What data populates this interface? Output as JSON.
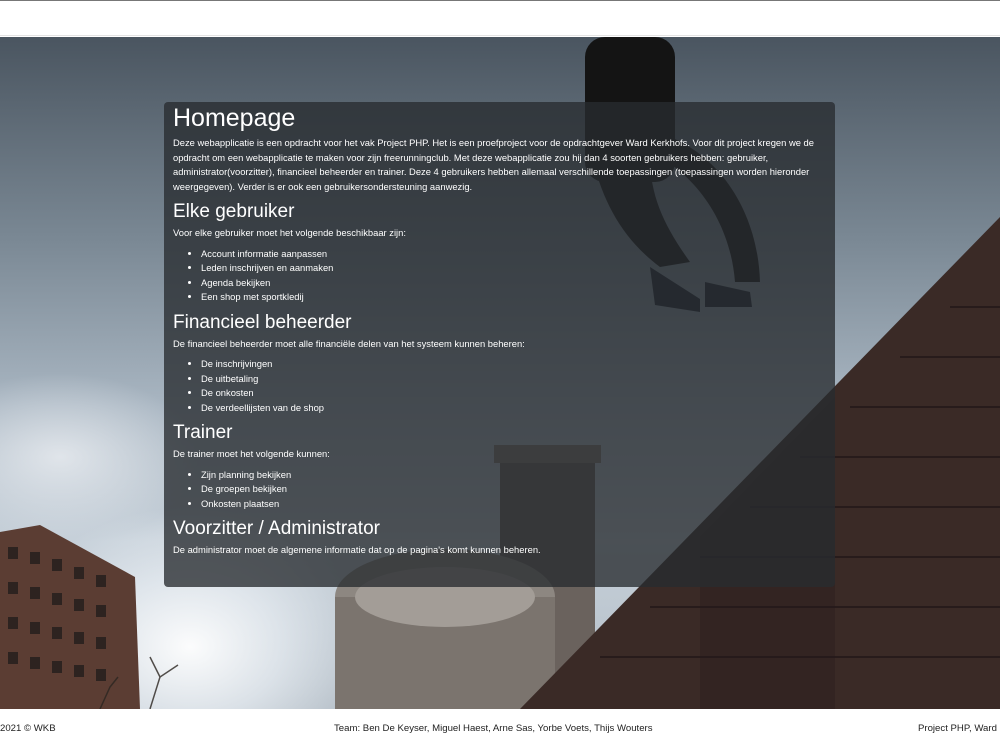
{
  "homepage": {
    "title": "Homepage",
    "intro": "Deze webapplicatie is een opdracht voor het vak Project PHP. Het is een proefproject voor de opdrachtgever Ward Kerkhofs. Voor dit project kregen we de opdracht om een webapplicatie te maken voor zijn freerunningclub. Met deze webapplicatie zou hij dan 4 soorten gebruikers hebben: gebruiker, administrator(voorzitter), financieel beheerder en trainer. Deze 4 gebruikers hebben allemaal verschillende toepassingen (toepassingen worden hieronder weergegeven). Verder is er ook een gebruikersondersteuning aanwezig."
  },
  "sections": [
    {
      "title": "Elke gebruiker",
      "text": "Voor elke gebruiker moet het volgende beschikbaar zijn:",
      "items": [
        "Account informatie aanpassen",
        "Leden inschrijven en aanmaken",
        "Agenda bekijken",
        "Een shop met sportkledij"
      ]
    },
    {
      "title": "Financieel beheerder",
      "text": "De financieel beheerder moet alle financiële delen van het systeem kunnen beheren:",
      "items": [
        "De inschrijvingen",
        "De uitbetaling",
        "De onkosten",
        "De verdeellijsten van de shop"
      ]
    },
    {
      "title": "Trainer",
      "text": "De trainer moet het volgende kunnen:",
      "items": [
        "Zijn planning bekijken",
        "De groepen bekijken",
        "Onkosten plaatsen"
      ]
    },
    {
      "title": "Voorzitter / Administrator",
      "text": "De administrator moet de algemene informatie dat op de pagina's komt kunnen beheren."
    }
  ],
  "footer": {
    "left": "2021 © WKB",
    "center": "Team: Ben De Keyser, Miguel Haest, Arne Sas, Yorbe Voets, Thijs Wouters",
    "right": "Project PHP, Ward I"
  },
  "colors": {
    "panel_background": "#282c30",
    "panel_text": "#ffffff",
    "brick": "#3a2a26"
  }
}
